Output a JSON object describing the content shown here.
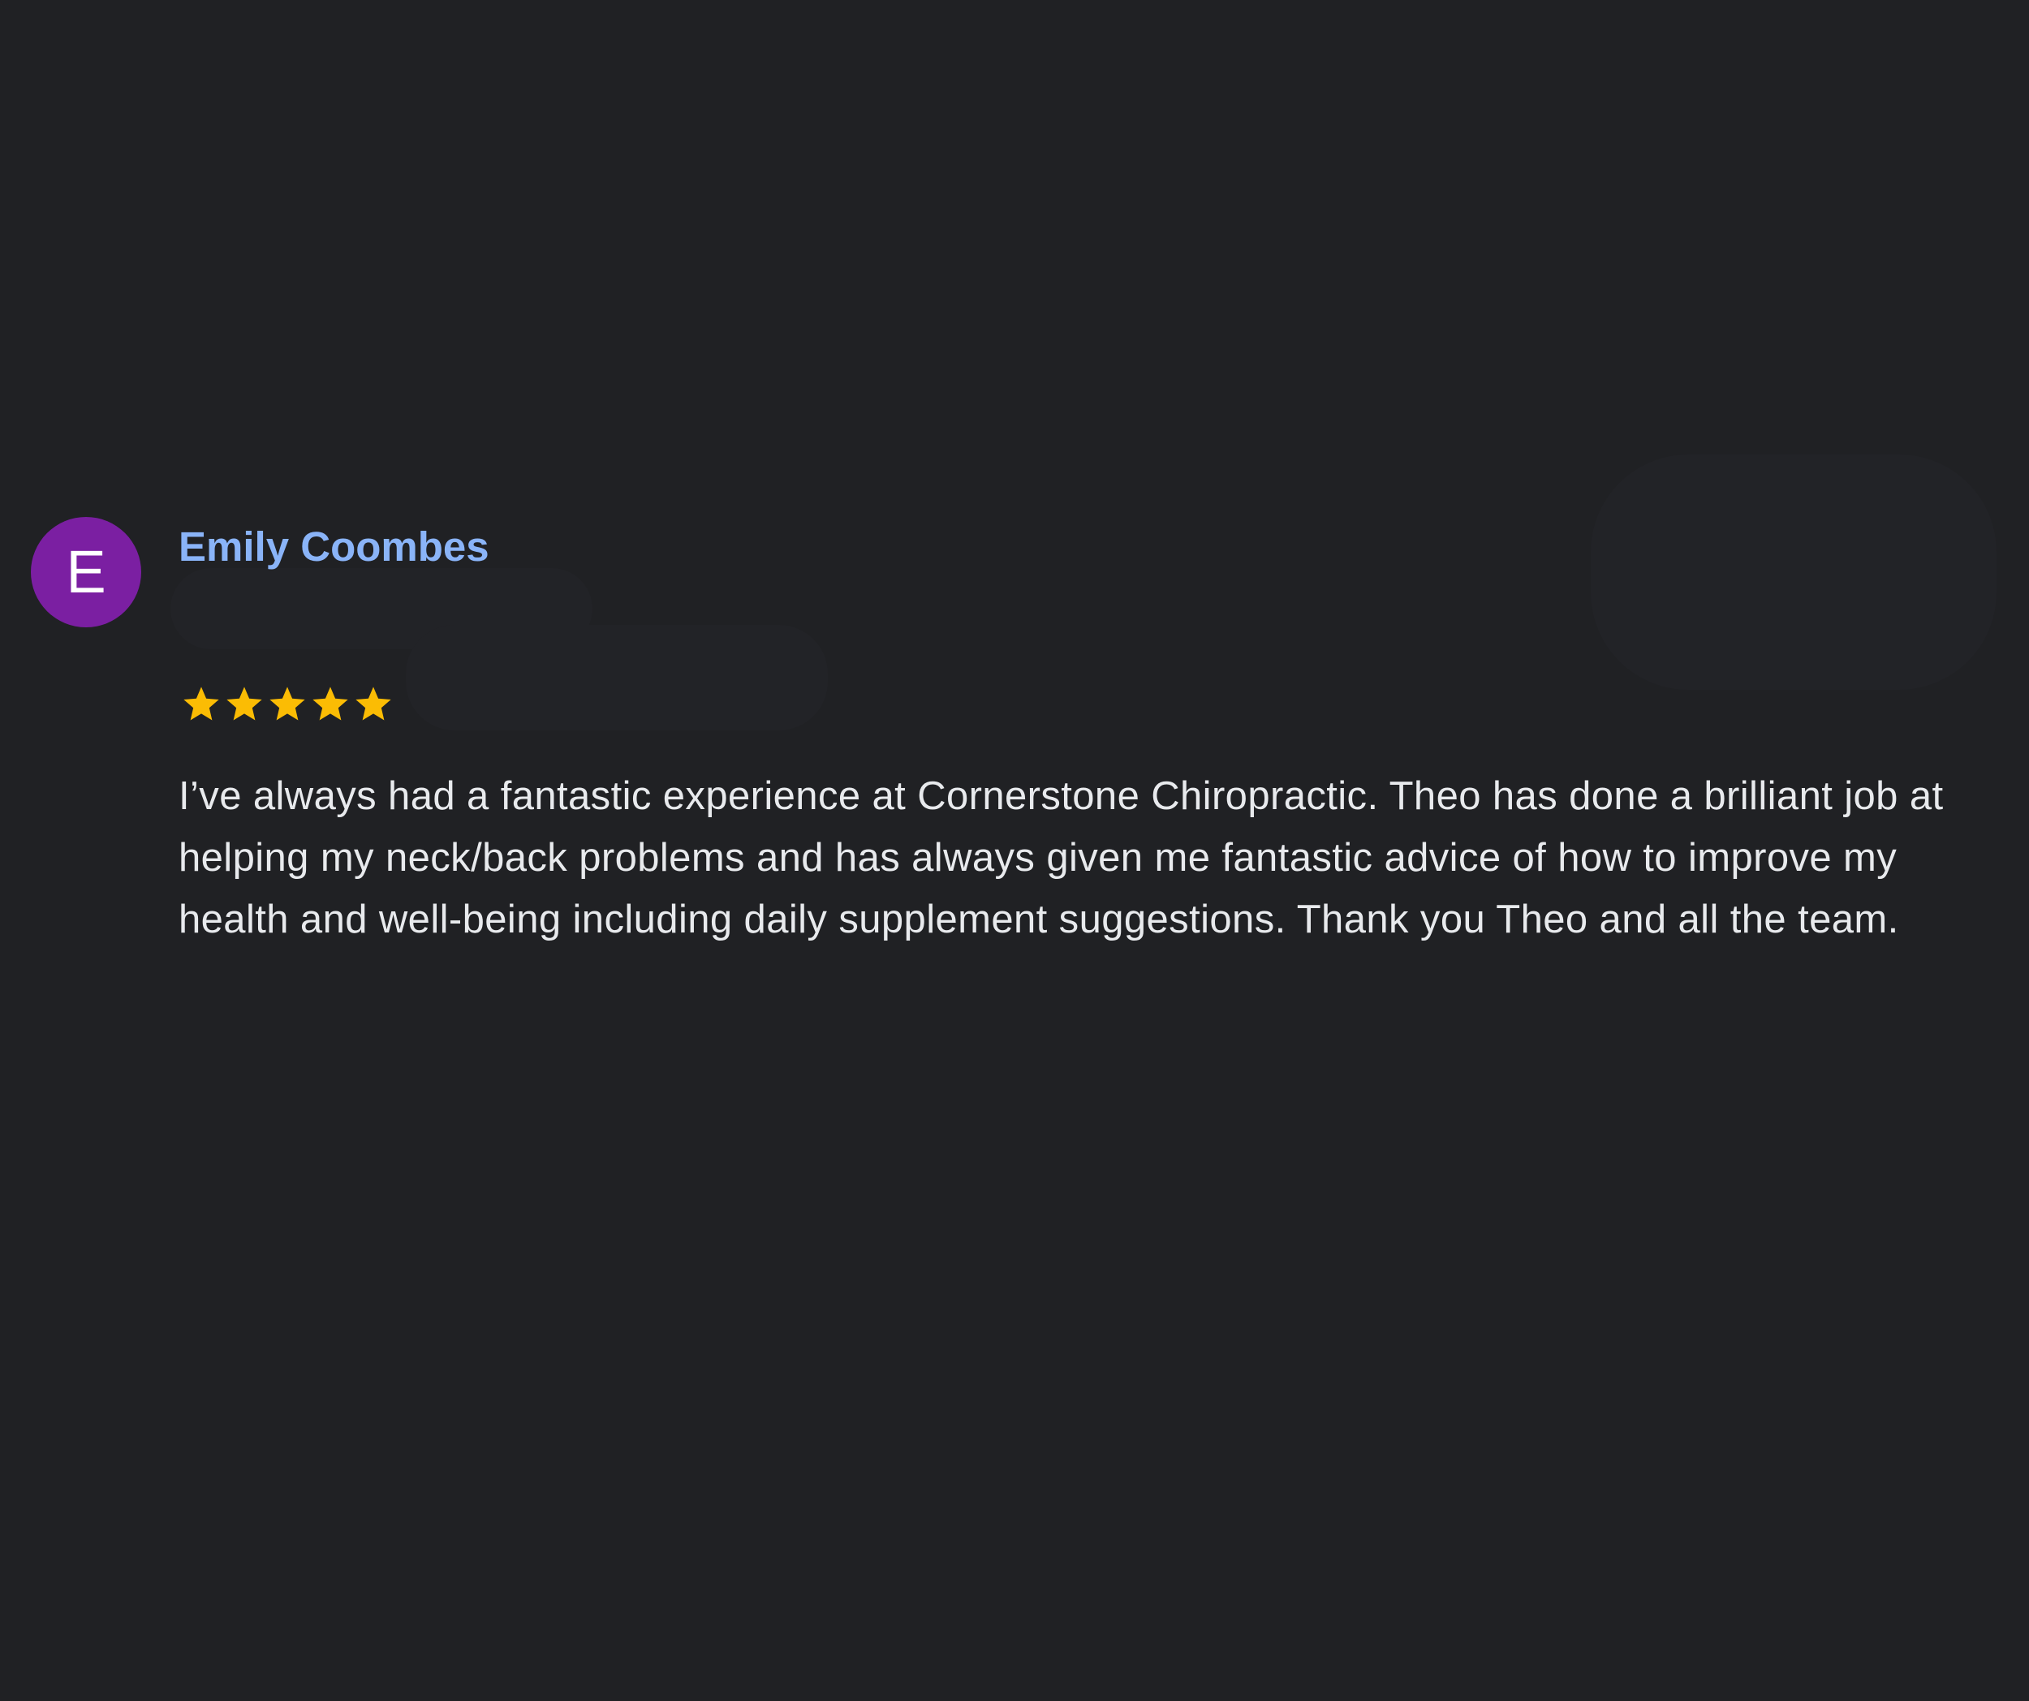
{
  "review": {
    "avatar_letter": "E",
    "avatar_color": "#7b1fa2",
    "reviewer_name": "Emily Coombes",
    "rating": 5,
    "rating_max": 5,
    "star_color": "#fbbc04",
    "text": "I’ve always had a fantastic experience at Cornerstone Chiropractic. Theo has done a brilliant job at helping my neck/back problems and has always given me fantastic advice of how to improve my health and well-being including daily supplement suggestions. Thank you Theo and all the team."
  },
  "icons": {
    "star": "star-icon"
  }
}
